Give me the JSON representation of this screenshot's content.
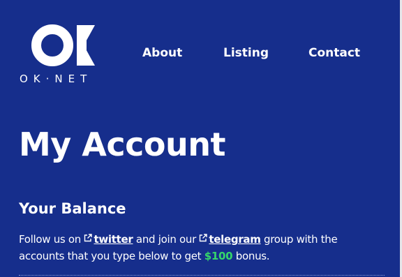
{
  "header": {
    "logo_text": "OK·NET",
    "nav": [
      {
        "label": "About"
      },
      {
        "label": "Listing"
      },
      {
        "label": "Contact"
      }
    ]
  },
  "page": {
    "title": "My Account",
    "section_title": "Your Balance",
    "promo": {
      "p1": "Follow us on ",
      "twitter": "twitter",
      "p2": " and join our ",
      "telegram": "telegram",
      "p3": " group with the accounts that you type below to get ",
      "bonus": "$100",
      "p4": " bonus."
    }
  },
  "colors": {
    "background": "#162e8c",
    "text": "#ffffff",
    "bonus": "#36d66a"
  },
  "icons": [
    "ok-logo-icon",
    "external-link-icon"
  ]
}
